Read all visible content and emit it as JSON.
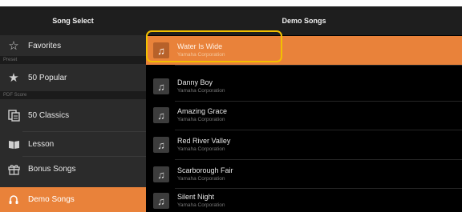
{
  "left_panel": {
    "title": "Song Select",
    "sections": [
      {
        "header": "",
        "items": [
          {
            "label": "Favorites",
            "icon": "star-outline-icon"
          }
        ]
      },
      {
        "header": "Preset",
        "items": [
          {
            "label": "50 Popular",
            "icon": "star-icon"
          }
        ]
      },
      {
        "header": "PDF Score",
        "items": [
          {
            "label": "50 Classics",
            "icon": "score-icon"
          },
          {
            "label": "Lesson",
            "icon": "book-icon"
          },
          {
            "label": "Bonus Songs",
            "icon": "gift-icon"
          }
        ]
      }
    ],
    "selected": {
      "label": "Demo Songs",
      "icon": "demo-icon"
    }
  },
  "right_panel": {
    "title": "Demo Songs",
    "songs": [
      {
        "title": "Water Is Wide",
        "subtitle": "Yamaha Corporation",
        "selected": true
      },
      {
        "title": "Danny Boy",
        "subtitle": "Yamaha Corporation"
      },
      {
        "title": "Amazing Grace",
        "subtitle": "Yamaha Corporation"
      },
      {
        "title": "Red River Valley",
        "subtitle": "Yamaha Corporation"
      },
      {
        "title": "Scarborough Fair",
        "subtitle": "Yamaha Corporation"
      },
      {
        "title": "Silent Night",
        "subtitle": "Yamaha Corporation"
      }
    ]
  },
  "colors": {
    "accent": "#e9823a",
    "highlight": "#f2c000"
  }
}
